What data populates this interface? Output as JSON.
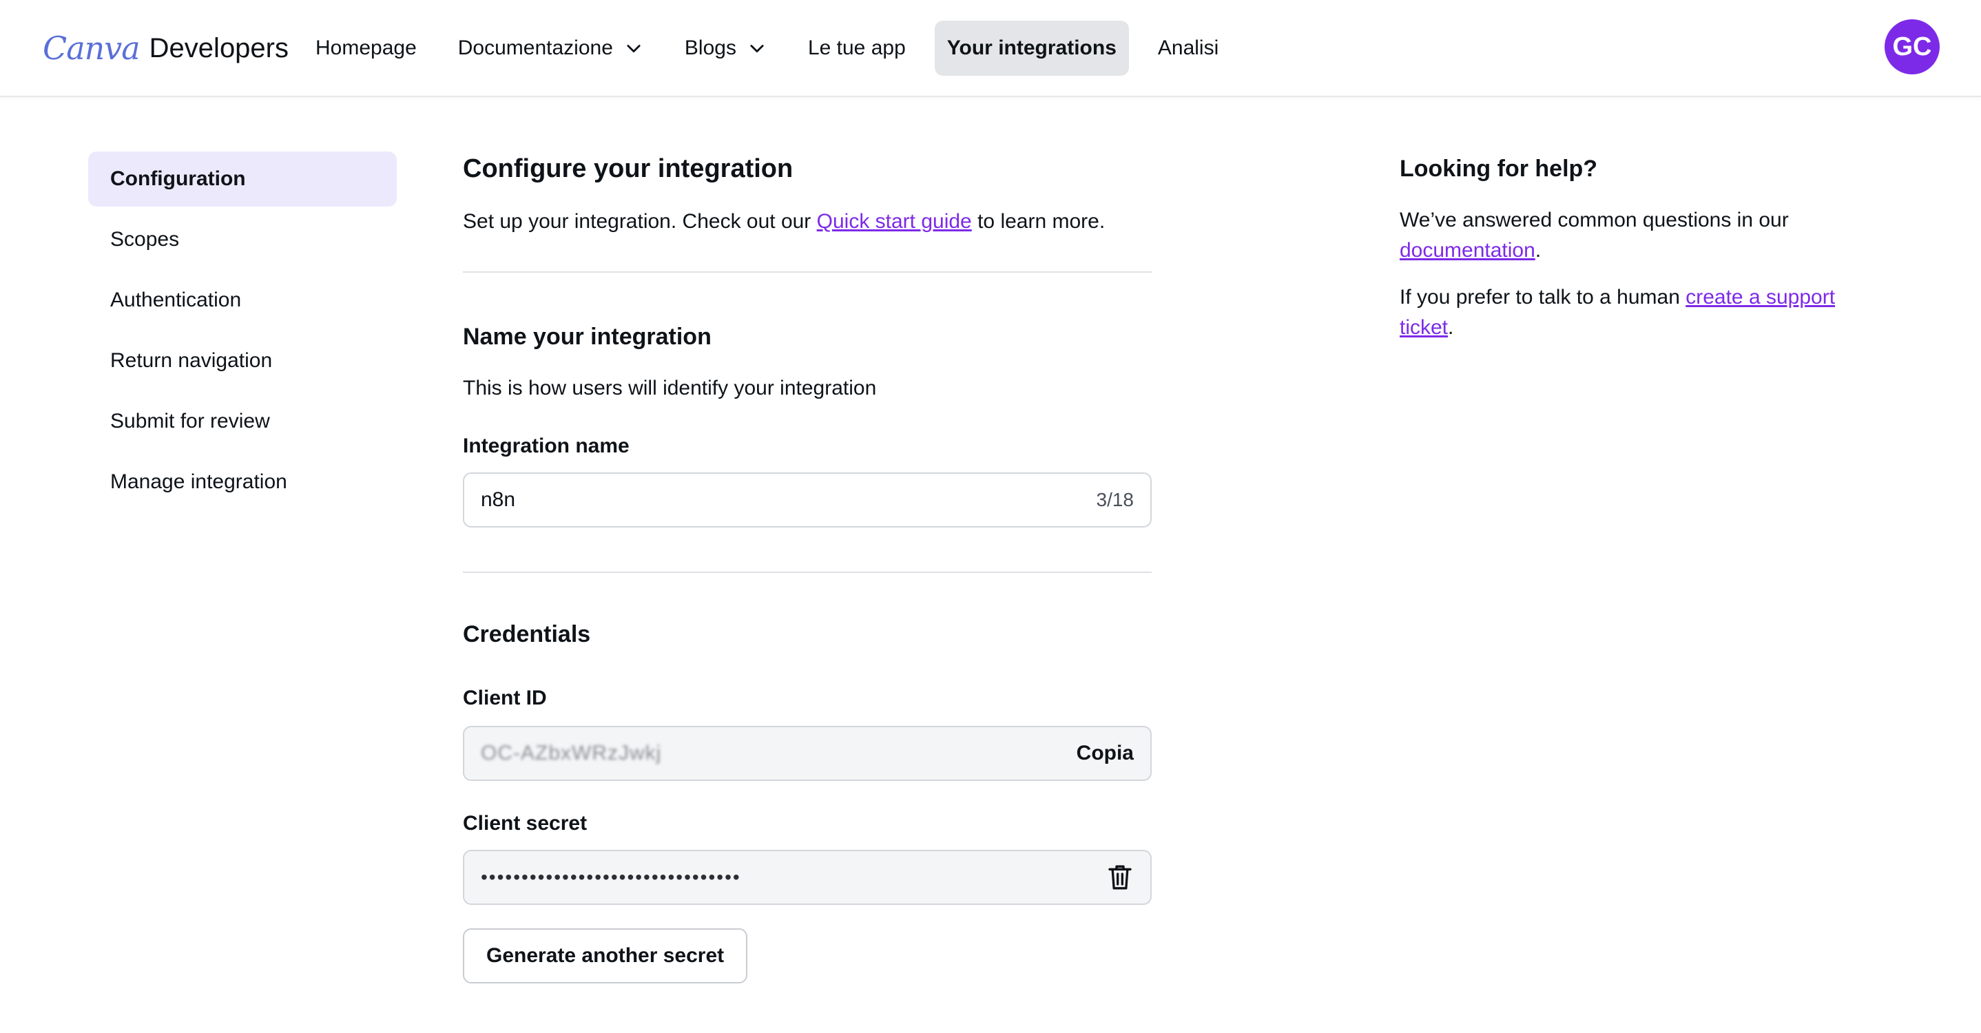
{
  "header": {
    "logo_brand": "Canva",
    "logo_product": "Developers",
    "nav": [
      {
        "label": "Homepage"
      },
      {
        "label": "Documentazione"
      },
      {
        "label": "Blogs"
      },
      {
        "label": "Le tue app"
      },
      {
        "label": "Your integrations"
      },
      {
        "label": "Analisi"
      }
    ],
    "active_nav": "Your integrations",
    "avatar_initials": "GC"
  },
  "sidebar": {
    "items": [
      {
        "label": "Configuration"
      },
      {
        "label": "Scopes"
      },
      {
        "label": "Authentication"
      },
      {
        "label": "Return navigation"
      },
      {
        "label": "Submit for review"
      },
      {
        "label": "Manage integration"
      }
    ],
    "active": "Configuration"
  },
  "main": {
    "title": "Configure your integration",
    "intro_before": "Set up your integration. Check out our ",
    "intro_link": "Quick start guide",
    "intro_after": " to learn more.",
    "name_section": {
      "heading": "Name your integration",
      "description": "This is how users will identify your integration",
      "field_label": "Integration name",
      "field_value": "n8n",
      "counter": "3/18"
    },
    "credentials": {
      "heading": "Credentials",
      "client_id_label": "Client ID",
      "client_id_value": "OC-AZbxWRzJwkj",
      "copy_label": "Copia",
      "client_secret_label": "Client secret",
      "client_secret_value": "••••••••••••••••••••••••••••••••",
      "generate_label": "Generate another secret"
    }
  },
  "help": {
    "heading": "Looking for help?",
    "p1_before": "We’ve answered common questions in our ",
    "p1_link": "documentation",
    "p1_after": ".",
    "p2_before": "If you prefer to talk to a human ",
    "p2_link": "create a support ticket",
    "p2_after": "."
  },
  "colors": {
    "accent": "#7d2ae8",
    "active_sidebar_bg": "#ede9fc",
    "active_nav_bg": "#e3e5e8"
  },
  "icons": [
    "chevron-down-icon",
    "trash-icon"
  ]
}
